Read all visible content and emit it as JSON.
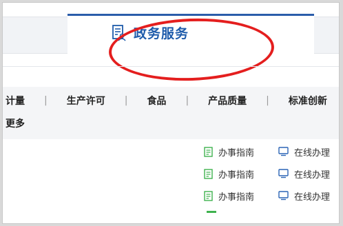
{
  "tabs": {
    "active": {
      "label": "政务服务",
      "icon": "document-person-icon"
    }
  },
  "categories": [
    "计量",
    "生产许可",
    "食品",
    "产品质量",
    "标准创新"
  ],
  "separator": "|",
  "more_label": "更多",
  "services": [
    {
      "guide": "办事指南",
      "online": "在线办理"
    },
    {
      "guide": "办事指南",
      "online": "在线办理"
    },
    {
      "guide": "办事指南",
      "online": "在线办理"
    }
  ],
  "colors": {
    "brand_blue": "#1f5cab",
    "highlight_red": "#e41e1e",
    "guide_icon_green": "#3fb24e",
    "online_icon_blue": "#2a64b5"
  }
}
